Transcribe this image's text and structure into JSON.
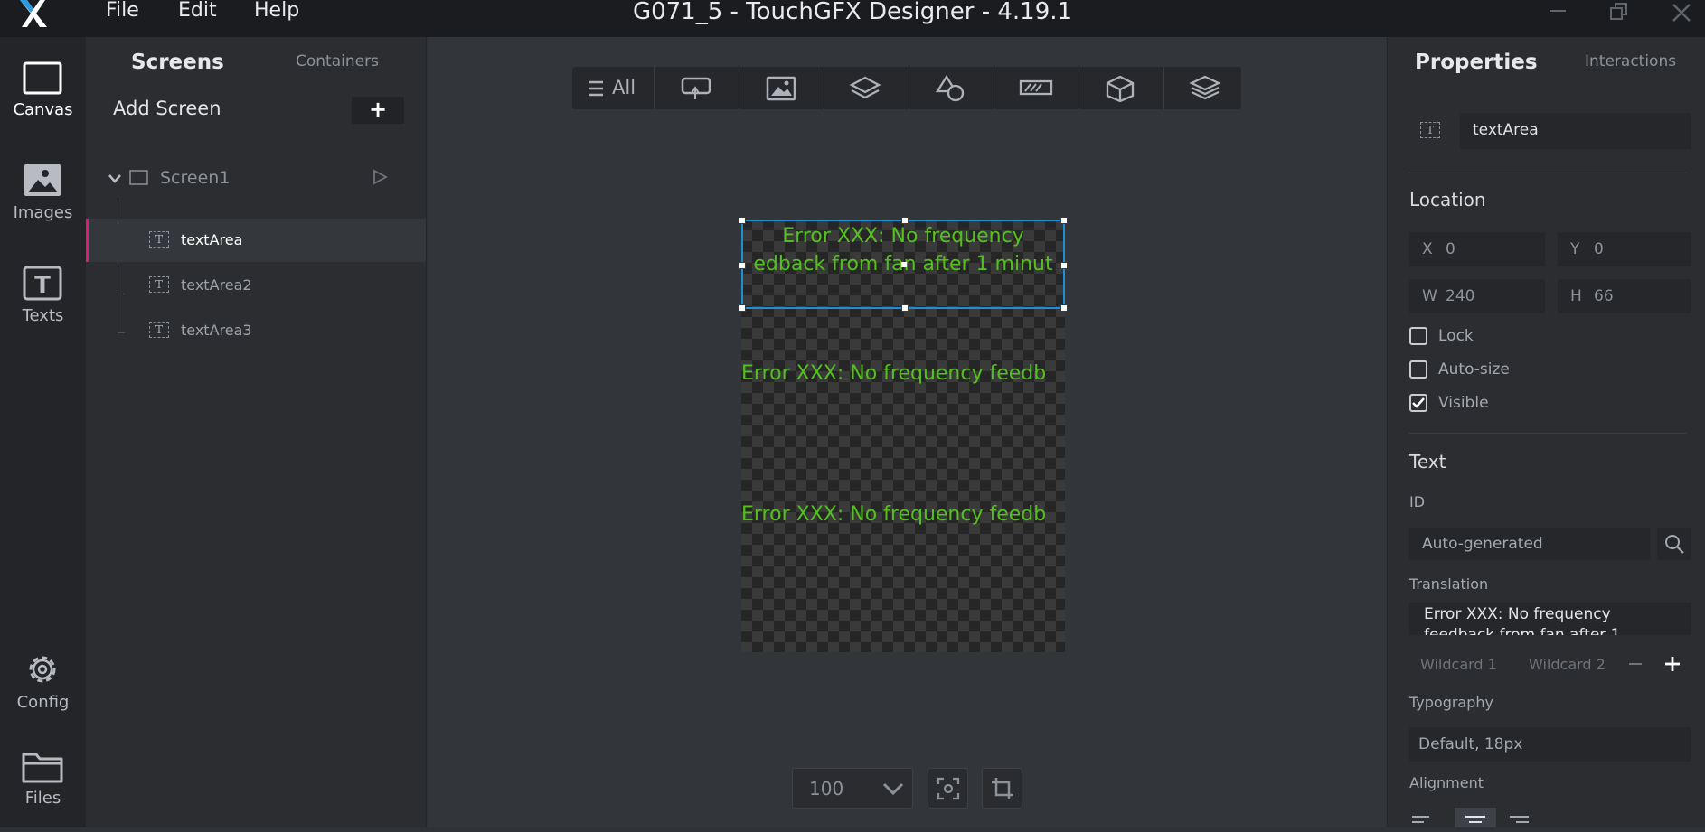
{
  "titlebar": {
    "menu": [
      "File",
      "Edit",
      "Help"
    ],
    "title": "G071_5 - TouchGFX Designer - 4.19.1"
  },
  "rail": {
    "items": [
      {
        "label": "Canvas",
        "icon": "canvas-icon"
      },
      {
        "label": "Images",
        "icon": "image-icon"
      },
      {
        "label": "Texts",
        "icon": "text-icon"
      },
      {
        "label": "Config",
        "icon": "gear-icon"
      },
      {
        "label": "Files",
        "icon": "folder-icon"
      }
    ]
  },
  "screens_panel": {
    "tabs": [
      "Screens",
      "Containers"
    ],
    "add_screen_label": "Add Screen",
    "add_button": "+",
    "tree": {
      "screen": "Screen1",
      "widgets": [
        "textArea",
        "textArea2",
        "textArea3"
      ]
    }
  },
  "toolbar": {
    "all_label": "All"
  },
  "canvas": {
    "text1_line1": "Error XXX: No frequency",
    "text1_line2": "edback from fan after 1 minut",
    "text2": "Error XXX: No frequency feedb",
    "text3": "Error XXX: No frequency feedb",
    "text_color": "#54c01e",
    "selection_color": "#1d8fd4"
  },
  "zoom": {
    "value": "100"
  },
  "properties": {
    "tabs": [
      "Properties",
      "Interactions"
    ],
    "widget_name": "textArea",
    "location_title": "Location",
    "x_label": "X",
    "x_value": "0",
    "y_label": "Y",
    "y_value": "0",
    "w_label": "W",
    "w_value": "240",
    "h_label": "H",
    "h_value": "66",
    "lock_label": "Lock",
    "autosize_label": "Auto-size",
    "visible_label": "Visible",
    "visible_checked": true,
    "text_title": "Text",
    "id_label": "ID",
    "id_value": "Auto-generated",
    "translation_label": "Translation",
    "translation_line1": "Error XXX: No frequency",
    "translation_line2": "feedback from fan after 1",
    "wildcard1": "Wildcard 1",
    "wildcard2": "Wildcard 2",
    "typography_label": "Typography",
    "typography_value": "Default, 18px",
    "alignment_label": "Alignment",
    "accent_color": "#e0197a"
  }
}
